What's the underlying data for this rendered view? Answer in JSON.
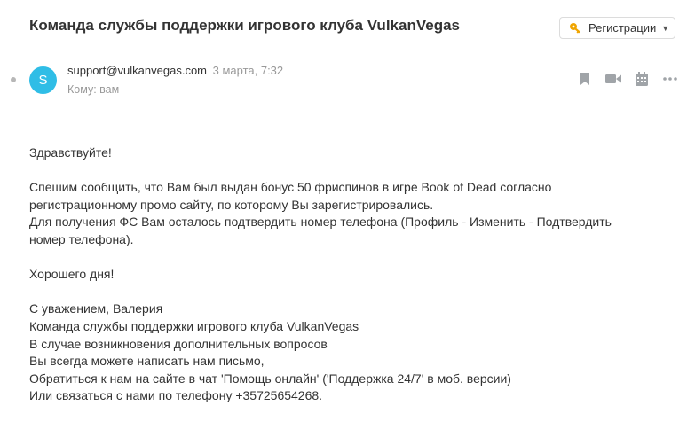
{
  "email": {
    "subject": "Команда службы поддержки игрового клуба VulkanVegas",
    "folder_button": {
      "icon": "key-icon",
      "label": "Регистрации",
      "accent": "#f0a500"
    },
    "sender": {
      "avatar_letter": "S",
      "avatar_color": "#2fbde6",
      "email": "support@vulkanvegas.com",
      "date": "3 марта, 7:32",
      "to": "Кому: вам"
    },
    "actions": [
      {
        "icon": "bookmark-icon"
      },
      {
        "icon": "video-icon"
      },
      {
        "icon": "calendar-icon"
      },
      {
        "icon": "more-icon"
      }
    ],
    "body": {
      "greeting": "Здравствуйте!",
      "p1_line1": "Спешим сообщить, что Вам был выдан бонус 50 фриспинов в игре Book of Dead согласно",
      "p1_line2": "регистрационному промо сайту, по которому Вы зарегистрировались.",
      "p1_line3": "Для получения ФС Вам осталось подтвердить номер телефона (Профиль - Изменить - Подтвердить",
      "p1_line4": "номер телефона).",
      "wish": "Хорошего дня!",
      "sig1": "С уважением, Валерия",
      "sig2": "Команда службы поддержки игрового клуба VulkanVegas",
      "sig3": "В случае возникновения дополнительных вопросов",
      "sig4": "Вы всегда можете написать нам письмо,",
      "sig5": "Обратиться к нам на сайте в чат 'Помощь онлайн' ('Поддержка 24/7' в моб. версии)",
      "sig6": "Или связаться с нами по телефону +35725654268."
    }
  }
}
